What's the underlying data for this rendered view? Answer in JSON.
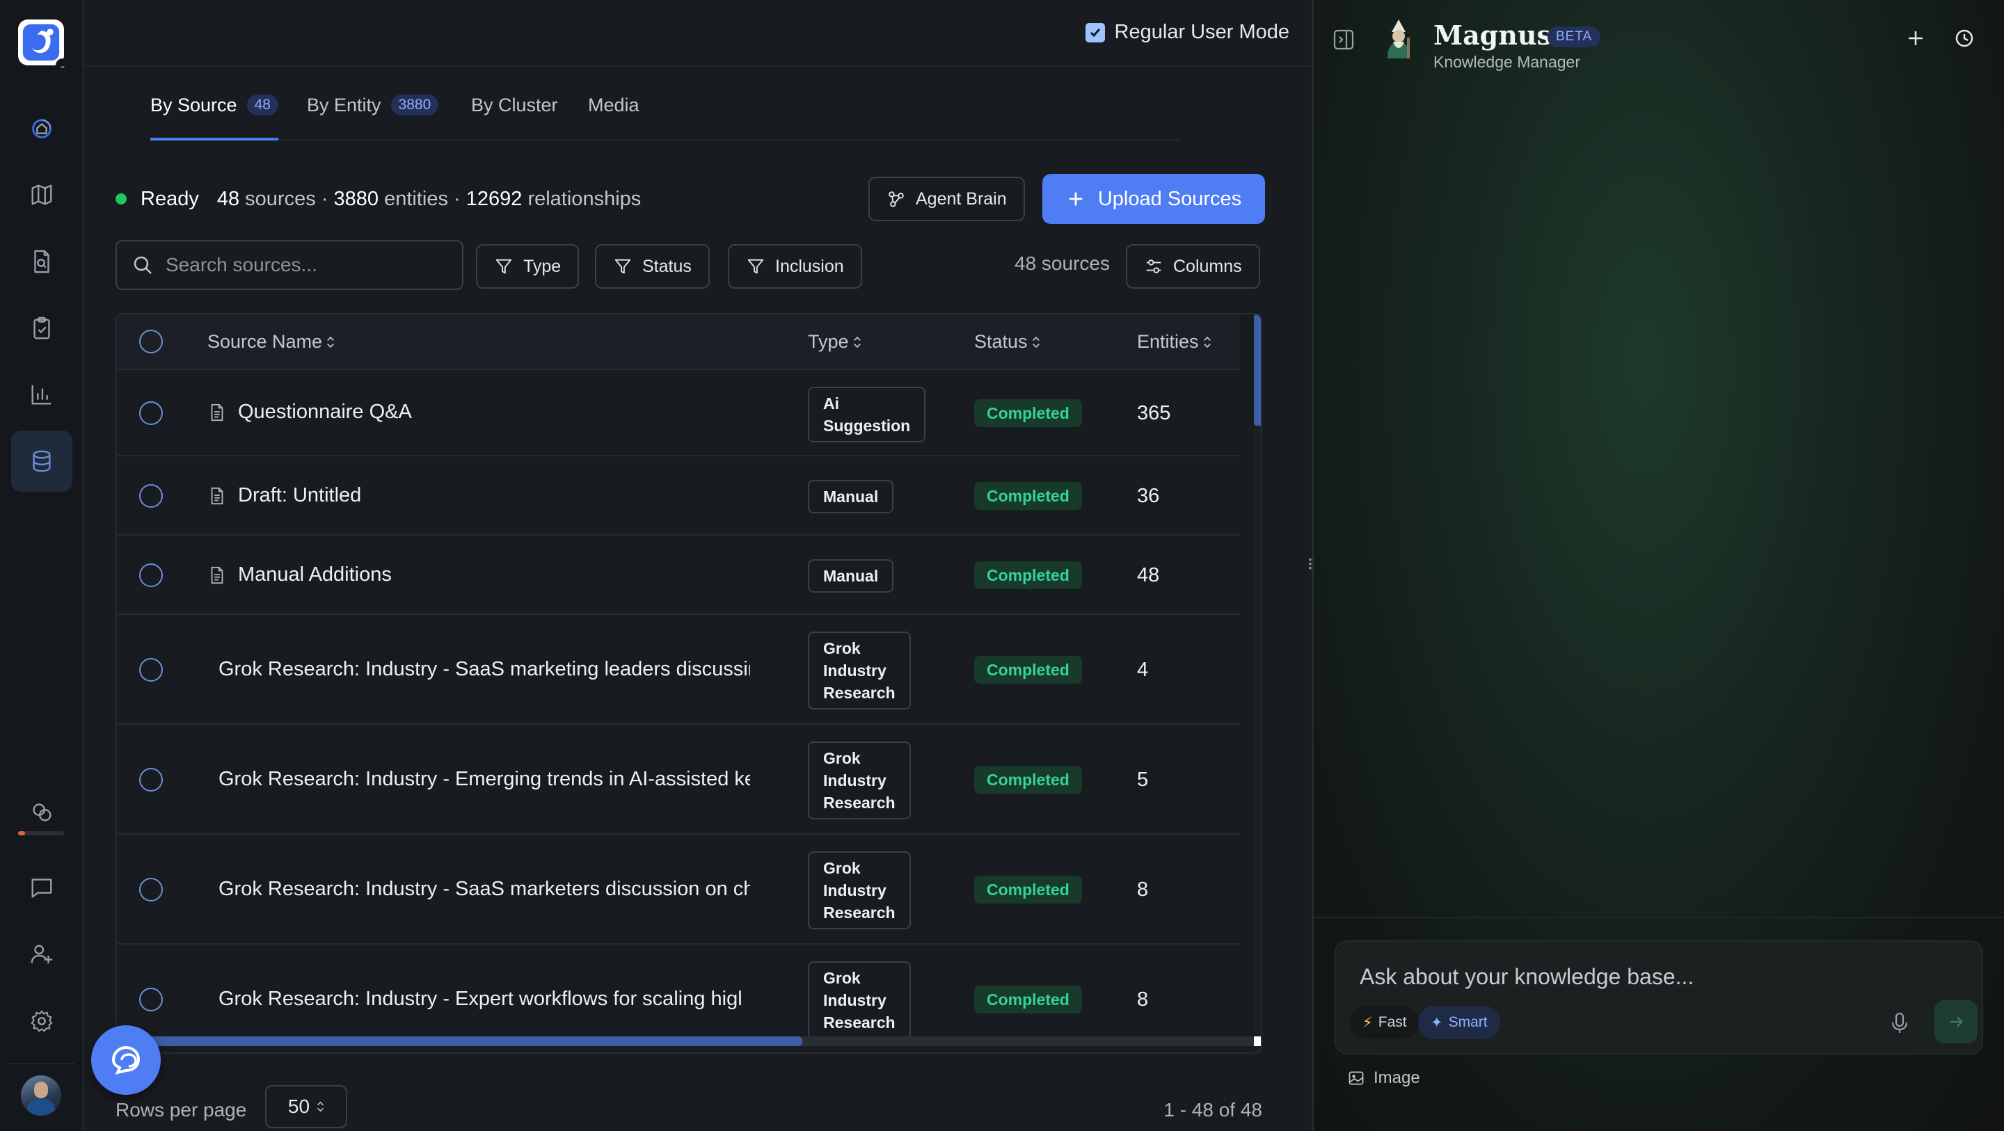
{
  "topbar": {
    "mode_label": "Regular User Mode"
  },
  "tabs": [
    {
      "label": "By Source",
      "badge": "48"
    },
    {
      "label": "By Entity",
      "badge": "3880"
    },
    {
      "label": "By Cluster"
    },
    {
      "label": "Media"
    }
  ],
  "summary": {
    "ready": "Ready",
    "sources_count": "48",
    "sources_label": "sources ·",
    "entities_count": "3880",
    "entities_label": "entities ·",
    "relationships_count": "12692",
    "relationships_label": "relationships"
  },
  "actions": {
    "agent_brain": "Agent Brain",
    "upload": "Upload Sources"
  },
  "filters": {
    "search_placeholder": "Search sources...",
    "type": "Type",
    "status": "Status",
    "inclusion": "Inclusion",
    "count_label": "48 sources",
    "columns": "Columns"
  },
  "table": {
    "headers": {
      "name": "Source Name",
      "type": "Type",
      "status": "Status",
      "entities": "Entities"
    },
    "rows": [
      {
        "name": "Questionnaire Q&A",
        "type": "Ai\nSuggestion",
        "status": "Completed",
        "entities": "365"
      },
      {
        "name": "Draft: Untitled",
        "type": "Manual",
        "status": "Completed",
        "entities": "36"
      },
      {
        "name": "Manual Additions",
        "type": "Manual",
        "status": "Completed",
        "entities": "48"
      },
      {
        "name": "Grok Research: Industry - SaaS marketing leaders discussir",
        "type": "Grok\nIndustry\nResearch",
        "status": "Completed",
        "entities": "4"
      },
      {
        "name": "Grok Research: Industry - Emerging trends in AI-assisted ke",
        "type": "Grok\nIndustry\nResearch",
        "status": "Completed",
        "entities": "5"
      },
      {
        "name": "Grok Research: Industry - SaaS marketers discussion on ch",
        "type": "Grok\nIndustry\nResearch",
        "status": "Completed",
        "entities": "8"
      },
      {
        "name": "Grok Research: Industry - Expert workflows for scaling higl",
        "type": "Grok\nIndustry\nResearch",
        "status": "Completed",
        "entities": "8"
      }
    ]
  },
  "pagination": {
    "rows_per_page_label": "Rows per page",
    "rows_per_page": "50",
    "range": "1 - 48 of 48"
  },
  "assistant": {
    "name": "Magnus",
    "badge": "BETA",
    "subtitle": "Knowledge Manager",
    "input_placeholder": "Ask about your knowledge base...",
    "fast": "Fast",
    "smart": "Smart",
    "image": "Image"
  },
  "colors": {
    "accent": "#4f7df3",
    "success": "#34d399",
    "status_dot": "#22c55e"
  }
}
